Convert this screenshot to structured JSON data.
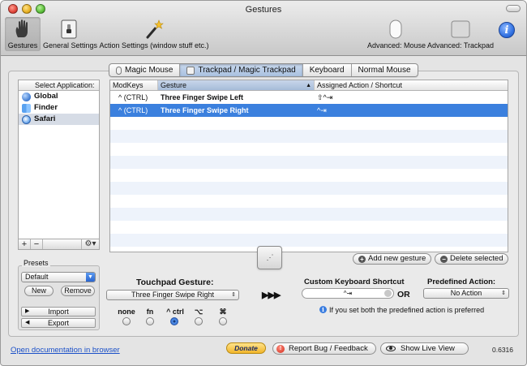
{
  "window": {
    "title": "Gestures"
  },
  "toolbar": {
    "items": [
      {
        "label": "Gestures",
        "icon": "hand-icon"
      },
      {
        "label": "General Settings",
        "icon": "switch-icon"
      },
      {
        "label": "Action Settings (window stuff etc.)",
        "icon": "magic-wand-icon"
      },
      {
        "label": "Advanced: Mouse",
        "icon": "mouse-icon"
      },
      {
        "label": "Advanced: Trackpad",
        "icon": "trackpad-icon"
      }
    ],
    "info_glyph": "i"
  },
  "device_tabs": [
    "Magic Mouse",
    "Trackpad / Magic Trackpad",
    "Keyboard",
    "Normal Mouse"
  ],
  "device_tab_selected": "Trackpad / Magic Trackpad",
  "app_list": {
    "header": "Select Application:",
    "items": [
      {
        "label": "Global",
        "icon": "globe-icon"
      },
      {
        "label": "Finder",
        "icon": "finder-icon"
      },
      {
        "label": "Safari",
        "icon": "safari-icon"
      }
    ],
    "selected": "Safari",
    "add": "+",
    "remove": "−",
    "gear": "⚙▾"
  },
  "gesture_table": {
    "columns": [
      "ModKeys",
      "Gesture",
      "Assigned Action / Shortcut"
    ],
    "sort_glyph": "▲",
    "rows": [
      {
        "modkeys": "^ (CTRL)",
        "gesture": "Three Finger Swipe Left",
        "action": "⇧^⇥"
      },
      {
        "modkeys": "^ (CTRL)",
        "gesture": "Three Finger Swipe Right",
        "action": "^⇥"
      }
    ],
    "selected_row": 1
  },
  "table_buttons": {
    "add": "Add new gesture",
    "delete": "Delete selected",
    "add_glyph": "+",
    "delete_glyph": "−"
  },
  "presets": {
    "label": "Presets",
    "selected": "Default",
    "new": "New",
    "remove": "Remove",
    "import": "Import",
    "export": "Export"
  },
  "gesture_config": {
    "title": "Touchpad Gesture:",
    "selected": "Three Finger Swipe Right",
    "modifiers": [
      {
        "label": "none",
        "checked": false
      },
      {
        "label": "fn",
        "checked": false
      },
      {
        "label": "^ ctrl",
        "checked": true
      },
      {
        "label": "⌥",
        "checked": false
      },
      {
        "label": "⌘",
        "checked": false
      }
    ],
    "arrows": "▶▶▶"
  },
  "shortcut": {
    "title": "Custom Keyboard Shortcut",
    "value": "^⇥",
    "or": "OR",
    "predefined_title": "Predefined Action:",
    "predefined_value": "No Action",
    "note": "If you set both the predefined action is preferred"
  },
  "bottom": {
    "doc_link": "Open documentation in browser",
    "donate": "Donate",
    "report": "Report Bug / Feedback",
    "live_view": "Show Live View",
    "version": "0.6316"
  }
}
